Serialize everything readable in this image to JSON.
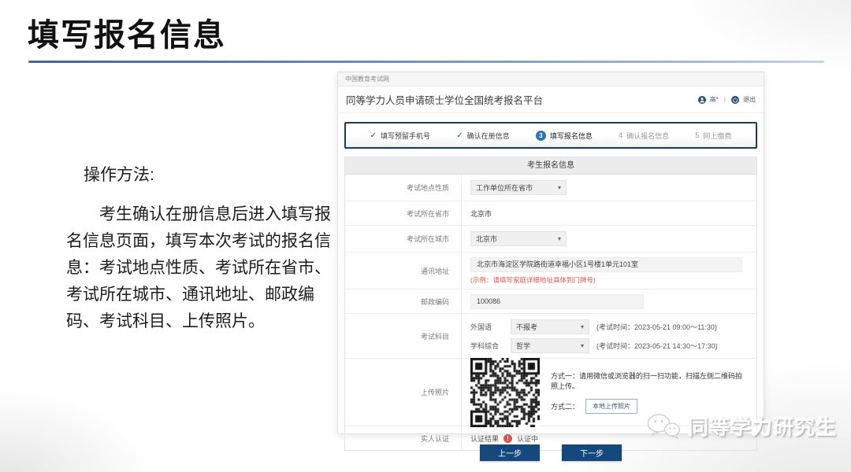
{
  "colors": {
    "accent_navy": "#15497e",
    "step_blue": "#2e74b5",
    "alert_red": "#d9534f",
    "rule_blue": "#44678f"
  },
  "glyphs": {
    "check": "✓",
    "caret": "▾",
    "warning": "!",
    "divider": "|"
  },
  "slide": {
    "title": "填写报名信息",
    "instructions": {
      "heading": "操作方法:",
      "body": "考生确认在册信息后进入填写报名信息页面，填写本次考试的报名信息：考试地点性质、考试所在省市、考试所在城市、通讯地址、邮政编码、考试科目、上传照片。"
    },
    "watermark": "同等学力研究生"
  },
  "webpage": {
    "site_name": "中国教育考试网",
    "portal_title": "同等学力人员申请硕士学位全国统考报名平台",
    "user": {
      "name": "高*",
      "logout": "退出"
    },
    "steps": [
      {
        "num": "✓",
        "label": "填写预留手机号",
        "state": "done"
      },
      {
        "num": "✓",
        "label": "确认在册信息",
        "state": "done"
      },
      {
        "num": "3",
        "label": "填写报名信息",
        "state": "current"
      },
      {
        "num": "4",
        "label": "确认报名信息",
        "state": "todo"
      },
      {
        "num": "5",
        "label": "网上缴费",
        "state": "todo"
      }
    ],
    "form": {
      "title": "考生报名信息",
      "exam_location_type": {
        "label": "考试地点性质",
        "value": "工作单位所在省市"
      },
      "exam_province": {
        "label": "考试所在省市",
        "value": "北京市"
      },
      "exam_city": {
        "label": "考试所在城市",
        "value": "北京市"
      },
      "address": {
        "label": "通讯地址",
        "value": "北京市海淀区学院路街道幸福小区1号楼1单元101室",
        "hint": "(示例：请填写家庭详细地址具体到门牌号)"
      },
      "postcode": {
        "label": "邮政编码",
        "value": "100086"
      },
      "subjects": {
        "label": "考试科目",
        "rows": [
          {
            "name": "外国语",
            "value": "不报考",
            "time": "(考试时间：2023-05-21 09:00～11:30)"
          },
          {
            "name": "学科综合",
            "value": "哲学",
            "time": "(考试时间：2023-05-21 14:30～17:30)"
          }
        ]
      },
      "photo": {
        "label": "上传照片",
        "method1": "方式一：请用微信或浏览器的扫一扫功能，扫描左侧二维码拍照上传。",
        "method2_label": "方式二：",
        "upload_button": "本地上传照片"
      },
      "verify": {
        "label": "实人认证",
        "result_label": "认证结果",
        "status": "认证中"
      }
    },
    "buttons": {
      "prev": "上一步",
      "next": "下一步"
    }
  }
}
